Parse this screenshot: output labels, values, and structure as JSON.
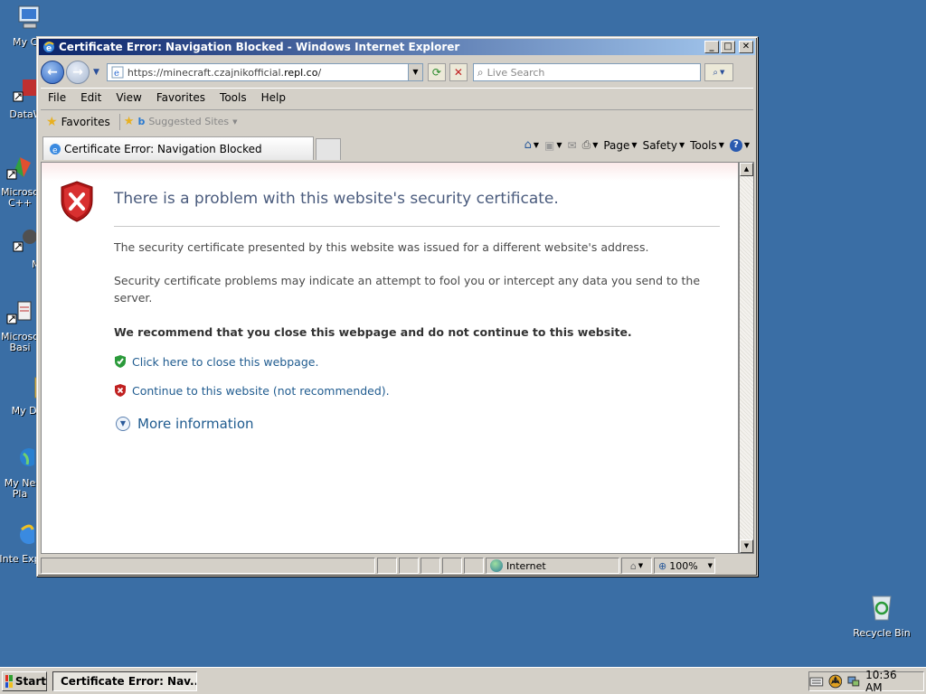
{
  "desktop": {
    "icons": [
      {
        "name": "my-computer",
        "label": "My Co"
      },
      {
        "name": "dataw",
        "label": "DataW"
      },
      {
        "name": "microsoft-cpp",
        "label": "Microso C++"
      },
      {
        "name": "my-1",
        "label": "My"
      },
      {
        "name": "microsoft-basic",
        "label": "Microso Basi"
      },
      {
        "name": "my-documents",
        "label": "My Doc"
      },
      {
        "name": "my-network",
        "label": "My Ne Pla"
      },
      {
        "name": "internet-explorer",
        "label": "Inte Exp"
      }
    ],
    "recycle_bin": "Recycle Bin"
  },
  "window": {
    "title": "Certificate Error: Navigation Blocked - Windows Internet Explorer",
    "address": {
      "prefix": "https://minecraft.czajnikofficial.",
      "domain": "repl.co",
      "suffix": "/"
    },
    "search_placeholder": "Live Search",
    "menu": [
      "File",
      "Edit",
      "View",
      "Favorites",
      "Tools",
      "Help"
    ],
    "favorites_label": "Favorites",
    "suggested_sites": "Suggested Sites",
    "tab_title": "Certificate Error: Navigation Blocked",
    "commands": {
      "page": "Page",
      "safety": "Safety",
      "tools": "Tools"
    },
    "status": {
      "zone": "Internet",
      "zoom": "100%"
    }
  },
  "content": {
    "title": "There is a problem with this website's security certificate.",
    "p1": "The security certificate presented by this website was issued for a different website's address.",
    "p2": "Security certificate problems may indicate an attempt to fool you or intercept any data you send to the server.",
    "recommend": "We recommend that you close this webpage and do not continue to this website.",
    "close_link": "Click here to close this webpage.",
    "continue_link": "Continue to this website (not recommended).",
    "more_info": "More information"
  },
  "taskbar": {
    "start": "Start",
    "task_label": "Certificate Error: Nav...",
    "clock": "10:36 AM"
  },
  "colors": {
    "desktop": "#3a6ea5",
    "title_gradient_start": "#0a246a",
    "link": "#1f5b8f",
    "heading": "#4a5b7d"
  }
}
